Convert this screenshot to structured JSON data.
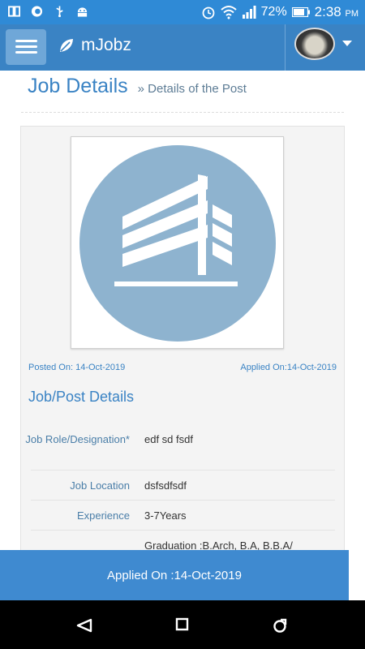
{
  "status_bar": {
    "icons": [
      "screen-mirror-icon",
      "chat-bubble-icon",
      "usb-icon",
      "android-icon",
      "alarm-icon",
      "wifi-icon",
      "signal-icon",
      "battery-icon"
    ],
    "battery_pct": "72%",
    "time": "2:38",
    "ampm": "PM"
  },
  "app_bar": {
    "brand": "mJobz",
    "accent": "#3a83c4"
  },
  "page": {
    "title": "Job Details",
    "subtitle": "» Details of the Post"
  },
  "job": {
    "posted_on": "Posted On: 14-Oct-2019",
    "applied_on_small": "Applied On:14-Oct-2019",
    "section_title": "Job/Post Details",
    "details": [
      {
        "label": "Job Role/Designation*",
        "value": "edf sd fsdf"
      },
      {
        "label": "Job Location",
        "value": "dsfsdfsdf"
      },
      {
        "label": "Experience",
        "value": "3-7Years"
      },
      {
        "label": "",
        "value": "Graduation :B.Arch, B.A, B.B.A/"
      }
    ]
  },
  "applied_bar": {
    "text": "Applied On :14-Oct-2019"
  },
  "nav": {
    "icons": [
      "back-icon",
      "home-icon",
      "recents-icon"
    ]
  }
}
